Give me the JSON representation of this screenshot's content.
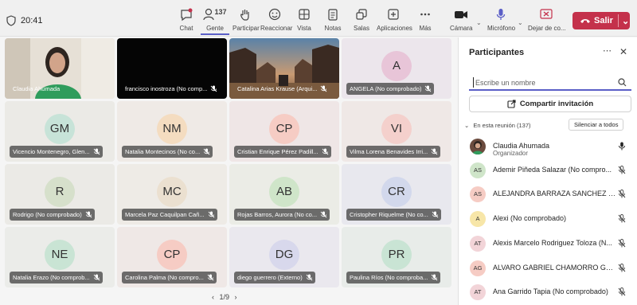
{
  "topbar": {
    "time": "20:41",
    "buttons": [
      {
        "id": "chat",
        "label": "Chat",
        "icon": "chat-icon"
      },
      {
        "id": "gente",
        "label": "Gente",
        "icon": "people-icon",
        "count": "137"
      },
      {
        "id": "participar",
        "label": "Participar",
        "icon": "raise-hand-icon"
      },
      {
        "id": "reaccionar",
        "label": "Reaccionar",
        "icon": "smile-icon"
      },
      {
        "id": "vista",
        "label": "Vista",
        "icon": "grid-view-icon"
      },
      {
        "id": "notas",
        "label": "Notas",
        "icon": "notes-icon"
      },
      {
        "id": "salas",
        "label": "Salas",
        "icon": "rooms-icon"
      },
      {
        "id": "aplicaciones",
        "label": "Aplicaciones",
        "icon": "add-app-icon"
      },
      {
        "id": "mas",
        "label": "Más",
        "icon": "more-icon"
      },
      {
        "id": "camara",
        "label": "Cámara",
        "icon": "camera-icon"
      },
      {
        "id": "microfono",
        "label": "Micrófono",
        "icon": "mic-icon"
      },
      {
        "id": "dejar",
        "label": "Dejar de co...",
        "icon": "stop-share-icon"
      }
    ],
    "leave_label": "Salir",
    "accent": "#5b5fc7",
    "leave_color": "#c4314b"
  },
  "grid": {
    "tiles": [
      {
        "name": "Claudia Ahumada",
        "type": "video-person"
      },
      {
        "name": "francisco inostroza (No comp...",
        "type": "black"
      },
      {
        "name": "Catalina Arias Krause (Arqui...",
        "type": "video-game"
      },
      {
        "name": "ANGELA (No comprobado)",
        "initials": "A",
        "avatar_color": "#e8c5d8",
        "bg": "#ece6ec"
      },
      {
        "name": "Vicencio Montenegro, Glen...",
        "initials": "GM",
        "avatar_color": "#c7e3d8",
        "bg": "#ebeae6"
      },
      {
        "name": "Natalia Montecinos (No co...",
        "initials": "NM",
        "avatar_color": "#f4dcc0",
        "bg": "#efeae6"
      },
      {
        "name": "Cristian Enrique Pérez Padill...",
        "initials": "CP",
        "avatar_color": "#f6ccc4",
        "bg": "#efe6e6"
      },
      {
        "name": "Vilma Lorena Benavides Irri...",
        "initials": "VI",
        "avatar_color": "#f4d0cc",
        "bg": "#efe8e6"
      },
      {
        "name": "Rodrigo (No comprobado)",
        "initials": "R",
        "avatar_color": "#d6e0cb",
        "bg": "#ebeae6"
      },
      {
        "name": "Marcela Paz Caquilpan Cañ...",
        "initials": "MC",
        "avatar_color": "#ebe0d0",
        "bg": "#eeebe6"
      },
      {
        "name": "Rojas Barros, Aurora (No co...",
        "initials": "AB",
        "avatar_color": "#cfe5c9",
        "bg": "#ebece6"
      },
      {
        "name": "Cristopher Riquelme (No co...",
        "initials": "CR",
        "avatar_color": "#d2d8ec",
        "bg": "#e8e8ee"
      },
      {
        "name": "Natalia Erazo (No comprob...",
        "initials": "NE",
        "avatar_color": "#c9e4d4",
        "bg": "#ebece9"
      },
      {
        "name": "Carolina Palma (No compro...",
        "initials": "CP",
        "avatar_color": "#f6ccc4",
        "bg": "#efe8e6"
      },
      {
        "name": "diego guerrero (Externo)",
        "initials": "DG",
        "avatar_color": "#d8d8ec",
        "bg": "#eae8ee"
      },
      {
        "name": "Paulina Ríos (No comproba...",
        "initials": "PR",
        "avatar_color": "#c9e4d4",
        "bg": "#e8ece9"
      }
    ],
    "page": "1/9"
  },
  "panel": {
    "title": "Participantes",
    "search_placeholder": "Escribe un nombre",
    "share_label": "Compartir invitación",
    "section_label": "En esta reunión (137)",
    "silence_label": "Silenciar a todos",
    "participants": [
      {
        "name": "Claudia Ahumada",
        "role": "Organizador",
        "initials": "",
        "avatar_color": "#6b4b3e",
        "muted": false
      },
      {
        "name": "Ademir Piñeda Salazar (No compro...",
        "initials": "AS",
        "avatar_color": "#cfe5c9",
        "muted": true
      },
      {
        "name": "ALEJANDRA BARRAZA SANCHEZ (...",
        "initials": "AS",
        "avatar_color": "#f6ccc4",
        "muted": true
      },
      {
        "name": "Alexi (No comprobado)",
        "initials": "A",
        "avatar_color": "#f7e6a8",
        "muted": true
      },
      {
        "name": "Alexis Marcelo Rodriguez Toloza (N...",
        "initials": "AT",
        "avatar_color": "#f2d4d8",
        "muted": true
      },
      {
        "name": "ALVARO GABRIEL CHAMORRO GO...",
        "initials": "AG",
        "avatar_color": "#f6ccc4",
        "muted": true
      },
      {
        "name": "Ana Garrido Tapia (No comprobado)",
        "initials": "AT",
        "avatar_color": "#f2d4d8",
        "muted": true
      }
    ]
  }
}
